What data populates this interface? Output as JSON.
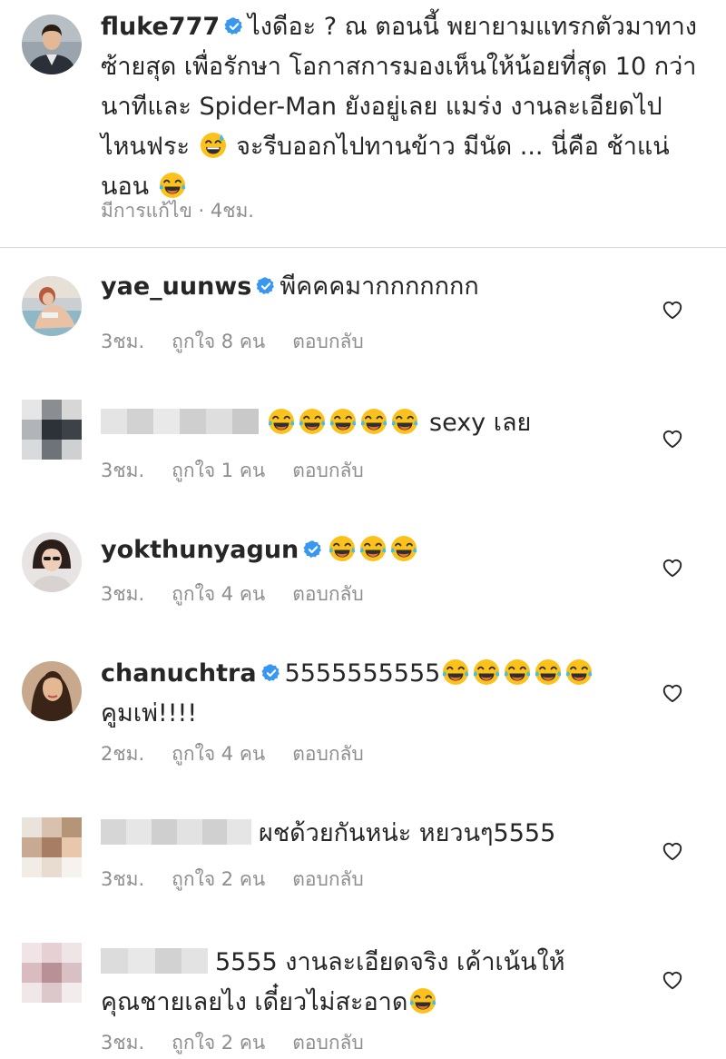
{
  "post": {
    "username": "fluke777",
    "lines": [
      "ไงดีอะ ? ณ ตอนนี้ พยายามแทรกตัวมาทาง",
      "ซ้ายสุด เพื่อรักษา โอกาสการมองเห็นให้น้อยที่สุด 10 กว่า",
      "นาทีและ Spider-Man ยังอยู่เลย แมร่ง งานละเอียดไป",
      "ไหนฟระ",
      "จะรีบออกไปทานข้าว มีนัด ... นี่คือ ช้าแน่",
      "นอน"
    ],
    "edited": "มีการแก้ไข",
    "time": "4ชม."
  },
  "comments": [
    {
      "username": "yae_uunws",
      "text": "พีคคคมากกกกกกก",
      "time": "3ชม.",
      "likes": "ถูกใจ 8 คน",
      "reply": "ตอบกลับ"
    },
    {
      "username": "",
      "text": "sexy เลย",
      "time": "3ชม.",
      "likes": "ถูกใจ 1 คน",
      "reply": "ตอบกลับ"
    },
    {
      "username": "yokthunyagun",
      "text": "",
      "time": "3ชม.",
      "likes": "ถูกใจ 4 คน",
      "reply": "ตอบกลับ"
    },
    {
      "username": "chanuchtra",
      "text": "5555555555",
      "text2": "คูมเพ่!!!!",
      "time": "2ชม.",
      "likes": "ถูกใจ 4 คน",
      "reply": "ตอบกลับ"
    },
    {
      "username": "",
      "text": "ผชด้วยกันหน่ะ หยวนๆ5555",
      "time": "3ชม.",
      "likes": "ถูกใจ 2 คน",
      "reply": "ตอบกลับ"
    },
    {
      "username": "",
      "text": "5555 งานละเอียดจริง เค้าเน้นให้",
      "text2": "คุณชายเลยไง เดี๋ยวไม่สะอาด",
      "time": "3ชม.",
      "likes": "ถูกใจ 2 คน",
      "reply": "ตอบกลับ"
    }
  ],
  "icons": {
    "verified": "verified-badge-icon",
    "heart": "heart-outline-icon",
    "emoji_laugh": "face-with-tears-of-joy-icon",
    "emoji_sweat": "grinning-face-with-sweat-icon"
  },
  "colors": {
    "verified": "#3897f0",
    "meta": "#8e8e8e",
    "divider": "#dbdbdb"
  }
}
